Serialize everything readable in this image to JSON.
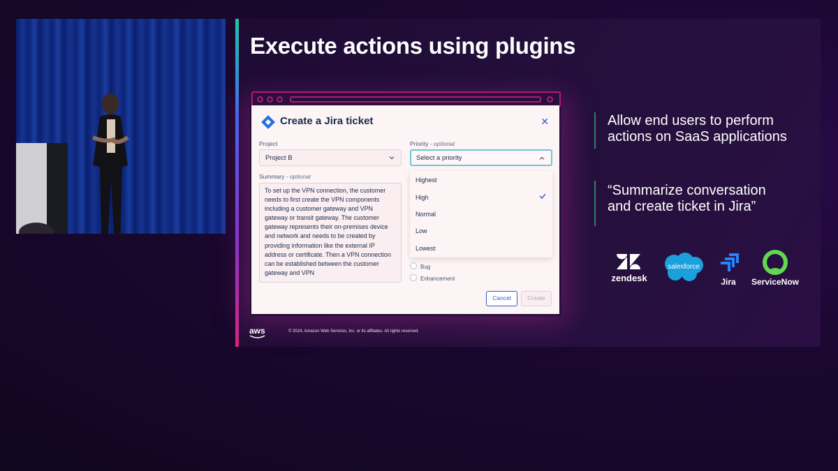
{
  "slide": {
    "title": "Execute actions using plugins",
    "bullets": [
      "Allow end users to perform actions on SaaS applications",
      "“Summarize conversation and create ticket in Jira”"
    ],
    "logos": [
      {
        "name": "zendesk",
        "label": "zendesk"
      },
      {
        "name": "salesforce",
        "label": "salesforce"
      },
      {
        "name": "jira",
        "label": "Jira"
      },
      {
        "name": "servicenow",
        "label": "ServiceNow"
      }
    ],
    "footer": {
      "brand": "aws",
      "copyright": "© 2024, Amazon Web Services, Inc. or its affiliates. All rights reserved."
    }
  },
  "dialog": {
    "title": "Create a Jira ticket",
    "project": {
      "label": "Project",
      "value": "Project B"
    },
    "priority": {
      "label": "Priority",
      "optional": "- optional",
      "placeholder": "Select a priority",
      "options": [
        "Highest",
        "High",
        "Normal",
        "Low",
        "Lowest"
      ],
      "checked": "High"
    },
    "summary": {
      "label": "Summary",
      "optional": "- optional",
      "value": "To set up the VPN connection, the customer needs to first create the VPN components including a customer gateway and VPN gateway or transit gateway. The customer gateway represents their on-premises device and network and needs to be created by providing information like the external IP address or certificate. Then a VPN connection can be established between the customer gateway and VPN"
    },
    "issue_types": [
      "Bug",
      "Enhancement"
    ],
    "buttons": {
      "cancel": "Cancel",
      "create": "Create"
    }
  },
  "colors": {
    "accent_link": "#2f5cc4",
    "focus_ring": "#6cc6d8",
    "browser_frame": "#b0197a",
    "salesforce_blue": "#1aa0dc",
    "jira_blue": "#2684ff",
    "servicenow_green": "#62d84e"
  }
}
